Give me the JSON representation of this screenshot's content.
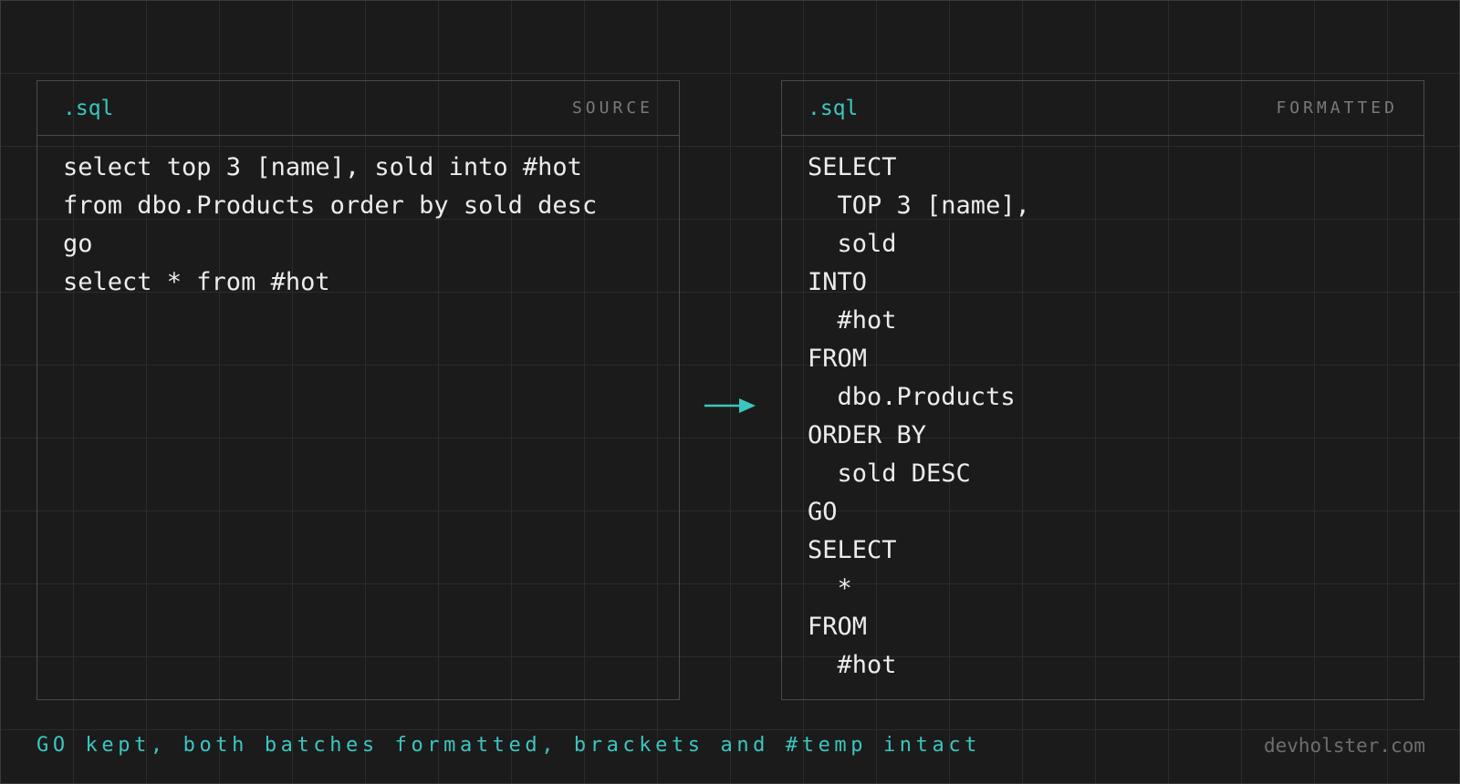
{
  "source_panel": {
    "extension": ".sql",
    "tag": "SOURCE",
    "lines": [
      "select top 3 [name], sold into #hot",
      "from dbo.Products order by sold desc",
      "go",
      "select * from #hot"
    ]
  },
  "formatted_panel": {
    "extension": ".sql",
    "tag": "FORMATTED",
    "lines": [
      "SELECT",
      "  TOP 3 [name],",
      "  sold",
      "INTO",
      "  #hot",
      "FROM",
      "  dbo.Products",
      "ORDER BY",
      "  sold DESC",
      "GO",
      "SELECT",
      "  *",
      "FROM",
      "  #hot"
    ]
  },
  "arrow": {
    "icon": "arrow-right-icon",
    "color": "#3cc6c0"
  },
  "footer": {
    "note": "GO kept, both batches formatted, brackets and #temp intact",
    "brand": "devholster.com"
  },
  "colors": {
    "accent": "#3cc6c0",
    "background": "#1b1b1b",
    "grid": "#2b2b2b",
    "panel_border": "#4a4a4a",
    "code_text": "#ececec",
    "muted": "#7a7a7a"
  }
}
